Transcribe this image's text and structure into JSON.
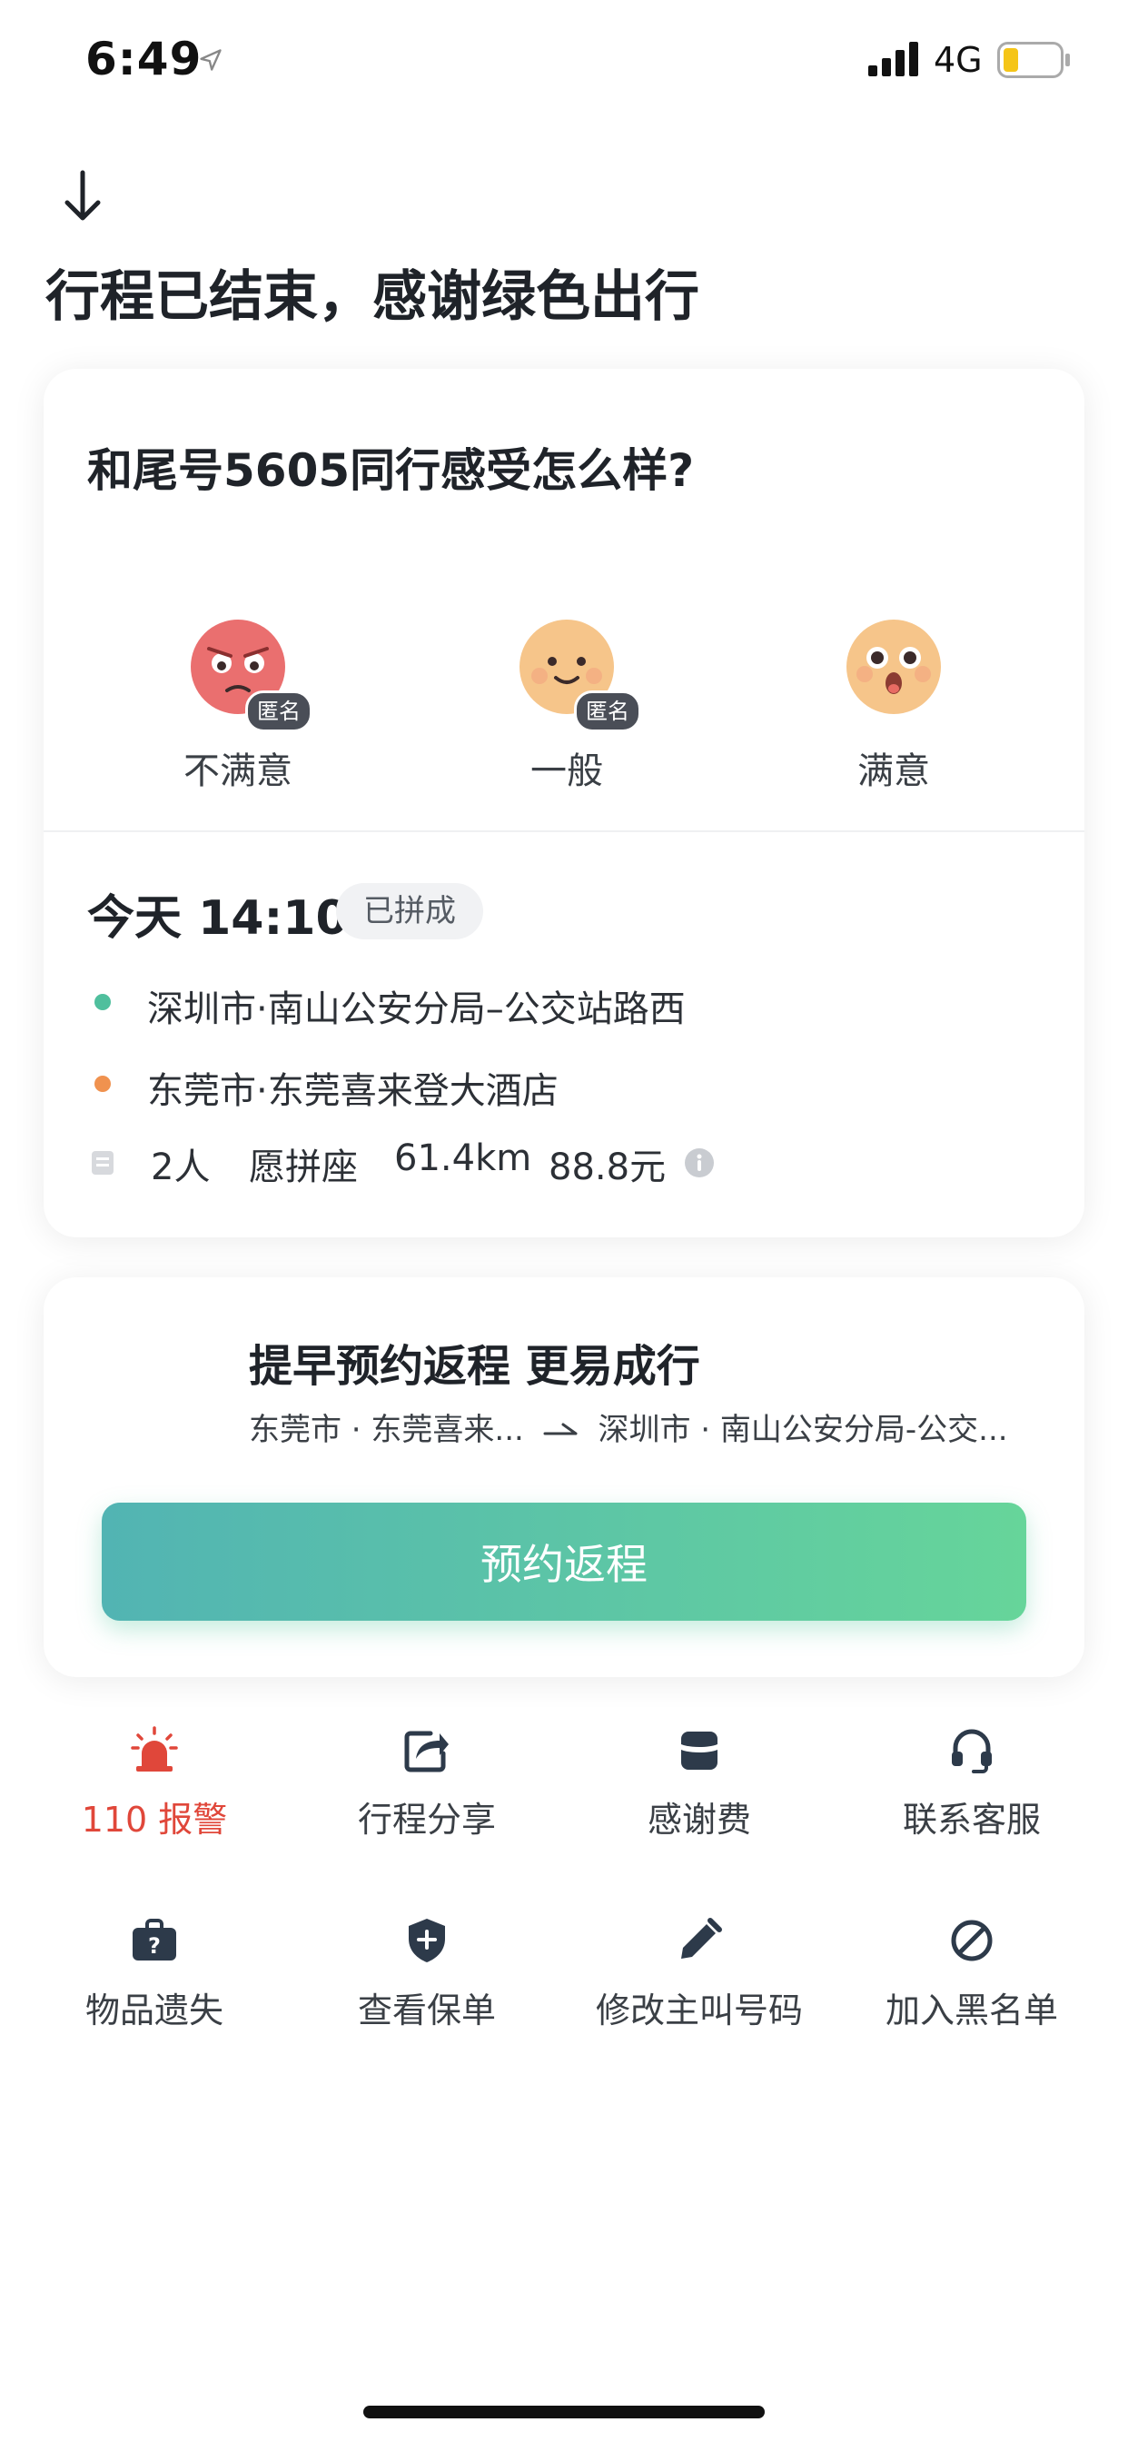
{
  "status_bar": {
    "time": "6:49",
    "network": "4G"
  },
  "header": {
    "title": "行程已结束，感谢绿色出行"
  },
  "rating": {
    "question": "和尾号5605同行感受怎么样?",
    "anonymous_badge": "匿名",
    "options": [
      {
        "label": "不满意",
        "icon": "angry-face-icon",
        "anonymous": true
      },
      {
        "label": "一般",
        "icon": "neutral-face-icon",
        "anonymous": true
      },
      {
        "label": "满意",
        "icon": "happy-face-icon",
        "anonymous": false
      }
    ]
  },
  "trip": {
    "time": "今天 14:10",
    "status": "已拼成",
    "origin": "深圳市·南山公安分局–公交站路西",
    "destination": "东莞市·东莞喜来登大酒店",
    "passengers": "2人",
    "seat_type": "愿拼座",
    "distance": "61.4km",
    "price": "88.8元",
    "colors": {
      "origin_dot": "#4fbf9d",
      "destination_dot": "#f0924f"
    }
  },
  "return_trip": {
    "title": "提早预约返程 更易成行",
    "route_from": "东莞市 · 东莞喜来...",
    "route_to": "深圳市 · 南山公安分局-公交...",
    "button_label": "预约返程"
  },
  "actions": [
    {
      "label": "110 报警",
      "icon": "alarm-siren-icon",
      "highlight": true
    },
    {
      "label": "行程分享",
      "icon": "share-icon",
      "highlight": false
    },
    {
      "label": "感谢费",
      "icon": "wallet-icon",
      "highlight": false
    },
    {
      "label": "联系客服",
      "icon": "headset-icon",
      "highlight": false
    },
    {
      "label": "物品遗失",
      "icon": "lost-item-icon",
      "highlight": false
    },
    {
      "label": "查看保单",
      "icon": "shield-plus-icon",
      "highlight": false
    },
    {
      "label": "修改主叫号码",
      "icon": "pencil-icon",
      "highlight": false
    },
    {
      "label": "加入黑名单",
      "icon": "block-icon",
      "highlight": false
    }
  ],
  "theme": {
    "accent": "#5cc6a6",
    "alert": "#e0473a",
    "text": "#1f2329",
    "icon": "#2d3a4a"
  }
}
